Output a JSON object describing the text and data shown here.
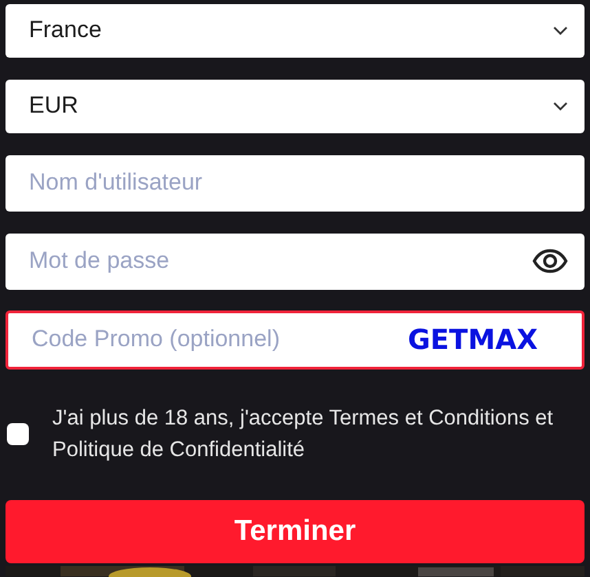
{
  "country_select": {
    "value": "France"
  },
  "currency_select": {
    "value": "EUR"
  },
  "username_field": {
    "placeholder": "Nom d'utilisateur"
  },
  "password_field": {
    "placeholder": "Mot de passe"
  },
  "promo_field": {
    "placeholder": "Code Promo (optionnel)",
    "highlighted": true,
    "code": "GETMAX"
  },
  "terms": {
    "checked": false,
    "text": "J'ai plus de 18 ans, j'accepte Termes et Conditions et Politique de Confidentialité"
  },
  "submit_button": "Terminer"
}
